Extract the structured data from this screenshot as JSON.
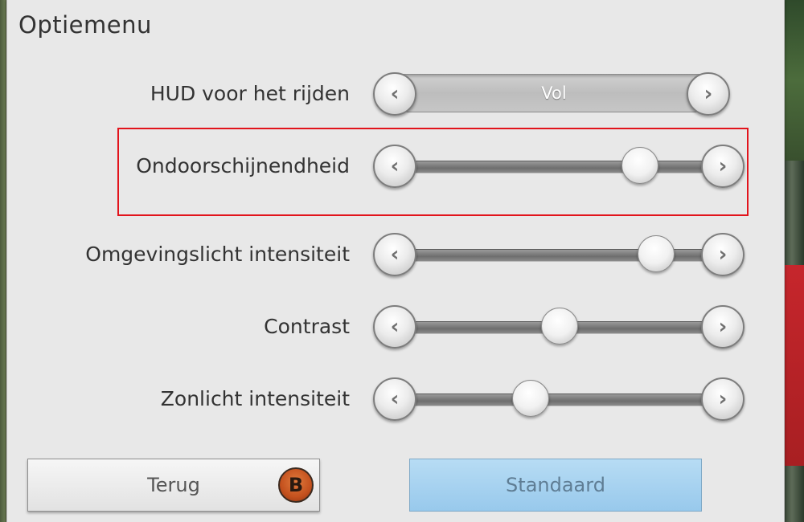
{
  "window": {
    "title": "Optiemenu"
  },
  "rows": [
    {
      "label": "HUD voor het rijden",
      "type": "selector",
      "value": "Vol",
      "left_icon": "chevron-left-icon",
      "right_icon": "chevron-right-icon"
    },
    {
      "label": "Ondoorschijnendheid",
      "type": "slider",
      "level": 0.74,
      "left_icon": "chevron-left-icon",
      "right_icon": "chevron-right-icon"
    },
    {
      "label": "Omgevingslicht intensiteit",
      "type": "slider",
      "level": 0.79,
      "left_icon": "chevron-left-icon",
      "right_icon": "chevron-right-icon"
    },
    {
      "label": "Contrast",
      "type": "slider",
      "level": 0.49,
      "left_icon": "chevron-left-icon",
      "right_icon": "chevron-right-icon"
    },
    {
      "label": "Zonlicht intensiteit",
      "type": "slider",
      "level": 0.4,
      "left_icon": "chevron-left-icon",
      "right_icon": "chevron-right-icon"
    }
  ],
  "buttons": {
    "back": {
      "label": "Terug",
      "hint_key": "B",
      "hint_icon": "gamepad-b-button-icon"
    },
    "default": {
      "label": "Standaard"
    }
  },
  "colors": {
    "panel_bg": "#e8e8e8",
    "highlight_border": "#e2141c",
    "default_button": "#a9d4f1",
    "b_button": "#c4511e"
  }
}
